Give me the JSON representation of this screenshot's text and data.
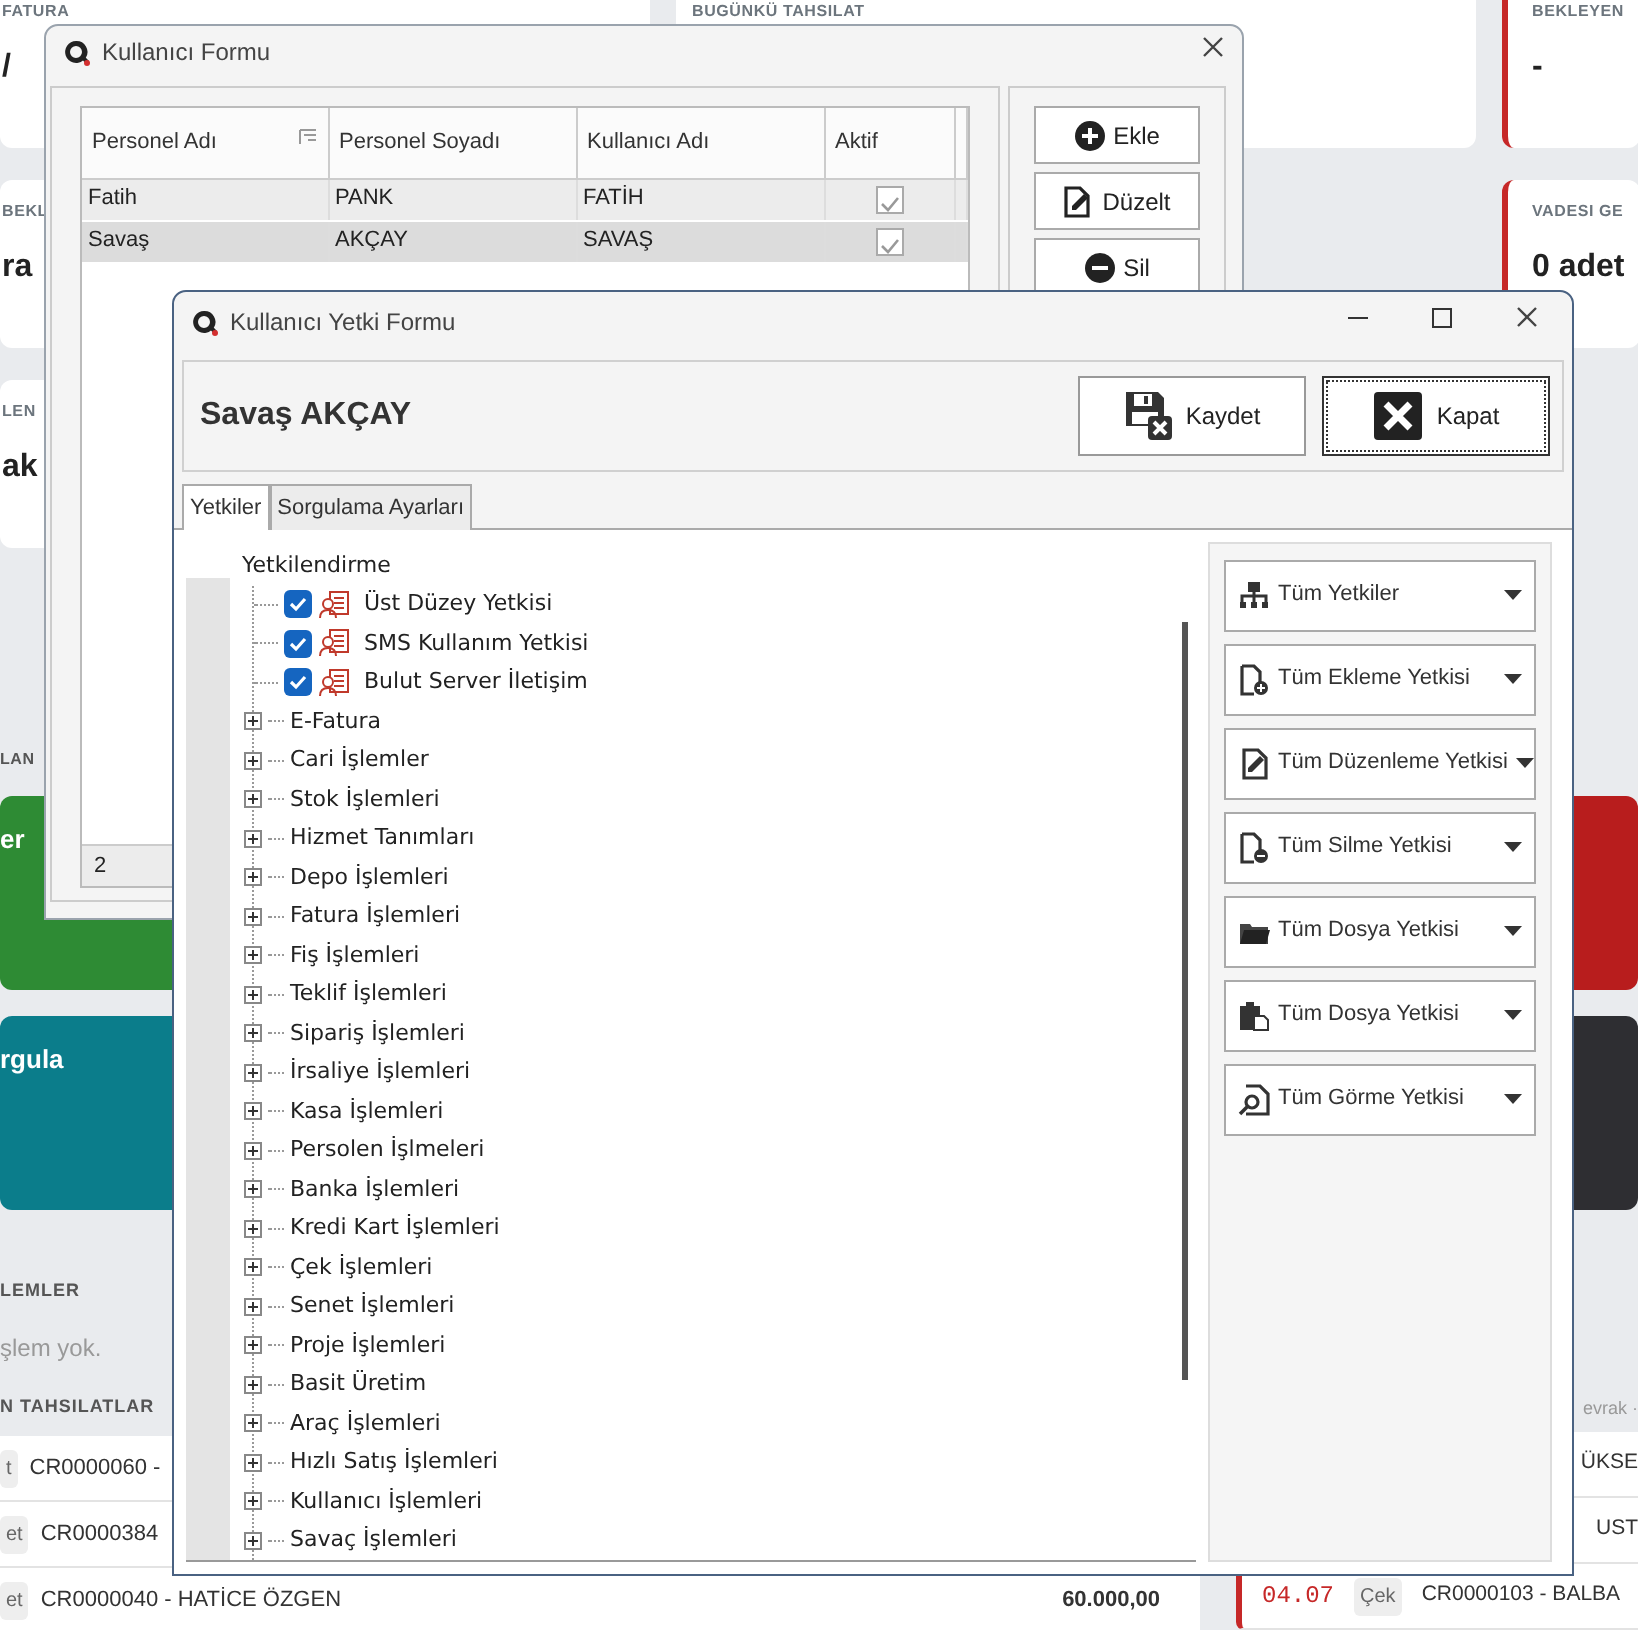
{
  "dashboard": {
    "left_cards": [
      {
        "title": "FATURA",
        "value": "/",
        "accent": false
      },
      {
        "title": "BEKL",
        "value": "ra",
        "accent": false
      },
      {
        "title": "LEN",
        "value": "ak",
        "accent": false
      }
    ],
    "middle_cards": [
      {
        "title": "BUGÜNKÜ TAHSILAT",
        "accent": false
      }
    ],
    "right_cards": [
      {
        "title": "BEKLEYEN",
        "value": "-",
        "accent": true
      },
      {
        "title": "VADESI GE",
        "value": "0 adet",
        "accent": true
      }
    ],
    "section_label": "LAN",
    "left_tiles": [
      {
        "label": "er",
        "color": "#2e8b34"
      },
      {
        "label": "rgula",
        "color": "#0b7d8b"
      }
    ],
    "right_tiles": [
      {
        "color": "#b81d1d"
      },
      {
        "color": "#2e2e32"
      }
    ],
    "recent_title": "LEMLER",
    "recent_empty": "şlem yok.",
    "right_note": "evrak ·",
    "collections_title": "N TAHSILATLAR",
    "collections": [
      {
        "badge": "t",
        "text": "CR0000060 -"
      },
      {
        "badge": "et",
        "text": "CR0000384"
      },
      {
        "badge": "et",
        "text": "CR0000040 - HATİCE ÖZGEN",
        "amount": "60.000,00"
      }
    ],
    "right_collections": [
      {
        "text": "ÜKSE"
      },
      {
        "text": "UST"
      },
      {
        "date": "04.07",
        "badge": "Çek",
        "text": "CR0000103 - BALBA"
      }
    ]
  },
  "user_form": {
    "title": "Kullanıcı Formu",
    "columns": [
      "Personel Adı",
      "Personel Soyadı",
      "Kullanıcı Adı",
      "Aktif"
    ],
    "rows": [
      {
        "cells": [
          "Fatih",
          "PANK",
          "FATİH"
        ],
        "active": true,
        "selected": false
      },
      {
        "cells": [
          "Savaş",
          "AKÇAY",
          "SAVAŞ"
        ],
        "active": true,
        "selected": true
      }
    ],
    "footer": "2",
    "buttons": [
      {
        "label": "Ekle",
        "kind": "add"
      },
      {
        "label": "Düzelt",
        "kind": "edit"
      },
      {
        "label": "Sil",
        "kind": "delete"
      }
    ]
  },
  "permission_form": {
    "title": "Kullanıcı Yetki Formu",
    "user_name": "Savaş AKÇAY",
    "buttons": [
      {
        "label": "Kaydet",
        "kind": "save",
        "focused": false
      },
      {
        "label": "Kapat",
        "kind": "close",
        "focused": true
      }
    ],
    "tabs": [
      {
        "label": "Yetkiler",
        "selected": true
      },
      {
        "label": "Sorgulama Ayarları",
        "selected": false
      }
    ],
    "tree": {
      "label": "Yetkilendirme",
      "children": [
        {
          "kind": "permission",
          "label": "Üst Düzey Yetkisi",
          "checked": true
        },
        {
          "kind": "permission",
          "label": "SMS Kullanım Yetkisi",
          "checked": true
        },
        {
          "kind": "permission",
          "label": "Bulut Server İletişim",
          "checked": true
        },
        {
          "kind": "group",
          "label": "E-Fatura",
          "expanded": false
        },
        {
          "kind": "group",
          "label": "Cari İşlemler",
          "expanded": false
        },
        {
          "kind": "group",
          "label": "Stok İşlemleri",
          "expanded": false
        },
        {
          "kind": "group",
          "label": "Hizmet Tanımları",
          "expanded": false
        },
        {
          "kind": "group",
          "label": "Depo İşlemleri",
          "expanded": false
        },
        {
          "kind": "group",
          "label": "Fatura İşlemleri",
          "expanded": false
        },
        {
          "kind": "group",
          "label": "Fiş İşlemleri",
          "expanded": false
        },
        {
          "kind": "group",
          "label": "Teklif İşlemleri",
          "expanded": false
        },
        {
          "kind": "group",
          "label": "Sipariş İşlemleri",
          "expanded": false
        },
        {
          "kind": "group",
          "label": "İrsaliye İşlemleri",
          "expanded": false
        },
        {
          "kind": "group",
          "label": "Kasa İşlemleri",
          "expanded": false
        },
        {
          "kind": "group",
          "label": "Persolen İşlmeleri",
          "expanded": false
        },
        {
          "kind": "group",
          "label": "Banka İşlemleri",
          "expanded": false
        },
        {
          "kind": "group",
          "label": "Kredi Kart İşlemleri",
          "expanded": false
        },
        {
          "kind": "group",
          "label": "Çek İşlemleri",
          "expanded": false
        },
        {
          "kind": "group",
          "label": "Senet İşlemleri",
          "expanded": false
        },
        {
          "kind": "group",
          "label": "Proje İşlemleri",
          "expanded": false
        },
        {
          "kind": "group",
          "label": "Basit Üretim",
          "expanded": false
        },
        {
          "kind": "group",
          "label": "Araç İşlemleri",
          "expanded": false
        },
        {
          "kind": "group",
          "label": "Hızlı Satış İşlemleri",
          "expanded": false
        },
        {
          "kind": "group",
          "label": "Kullanıcı İşlemleri",
          "expanded": false
        },
        {
          "kind": "group",
          "label": "Savaç İşlemleri",
          "expanded": false
        }
      ]
    },
    "permission_buttons": [
      {
        "label": "Tüm Yetkiler",
        "kind": "hierarchy"
      },
      {
        "label": "Tüm Ekleme Yetkisi",
        "kind": "doc-add"
      },
      {
        "label": "Tüm Düzenleme Yetkisi",
        "kind": "doc-edit"
      },
      {
        "label": "Tüm Silme Yetkisi",
        "kind": "doc-delete"
      },
      {
        "label": "Tüm Dosya Yetkisi",
        "kind": "folder"
      },
      {
        "label": "Tüm Dosya Yetkisi",
        "kind": "clipboard"
      },
      {
        "label": "Tüm Görme Yetkisi",
        "kind": "doc-search"
      }
    ]
  }
}
